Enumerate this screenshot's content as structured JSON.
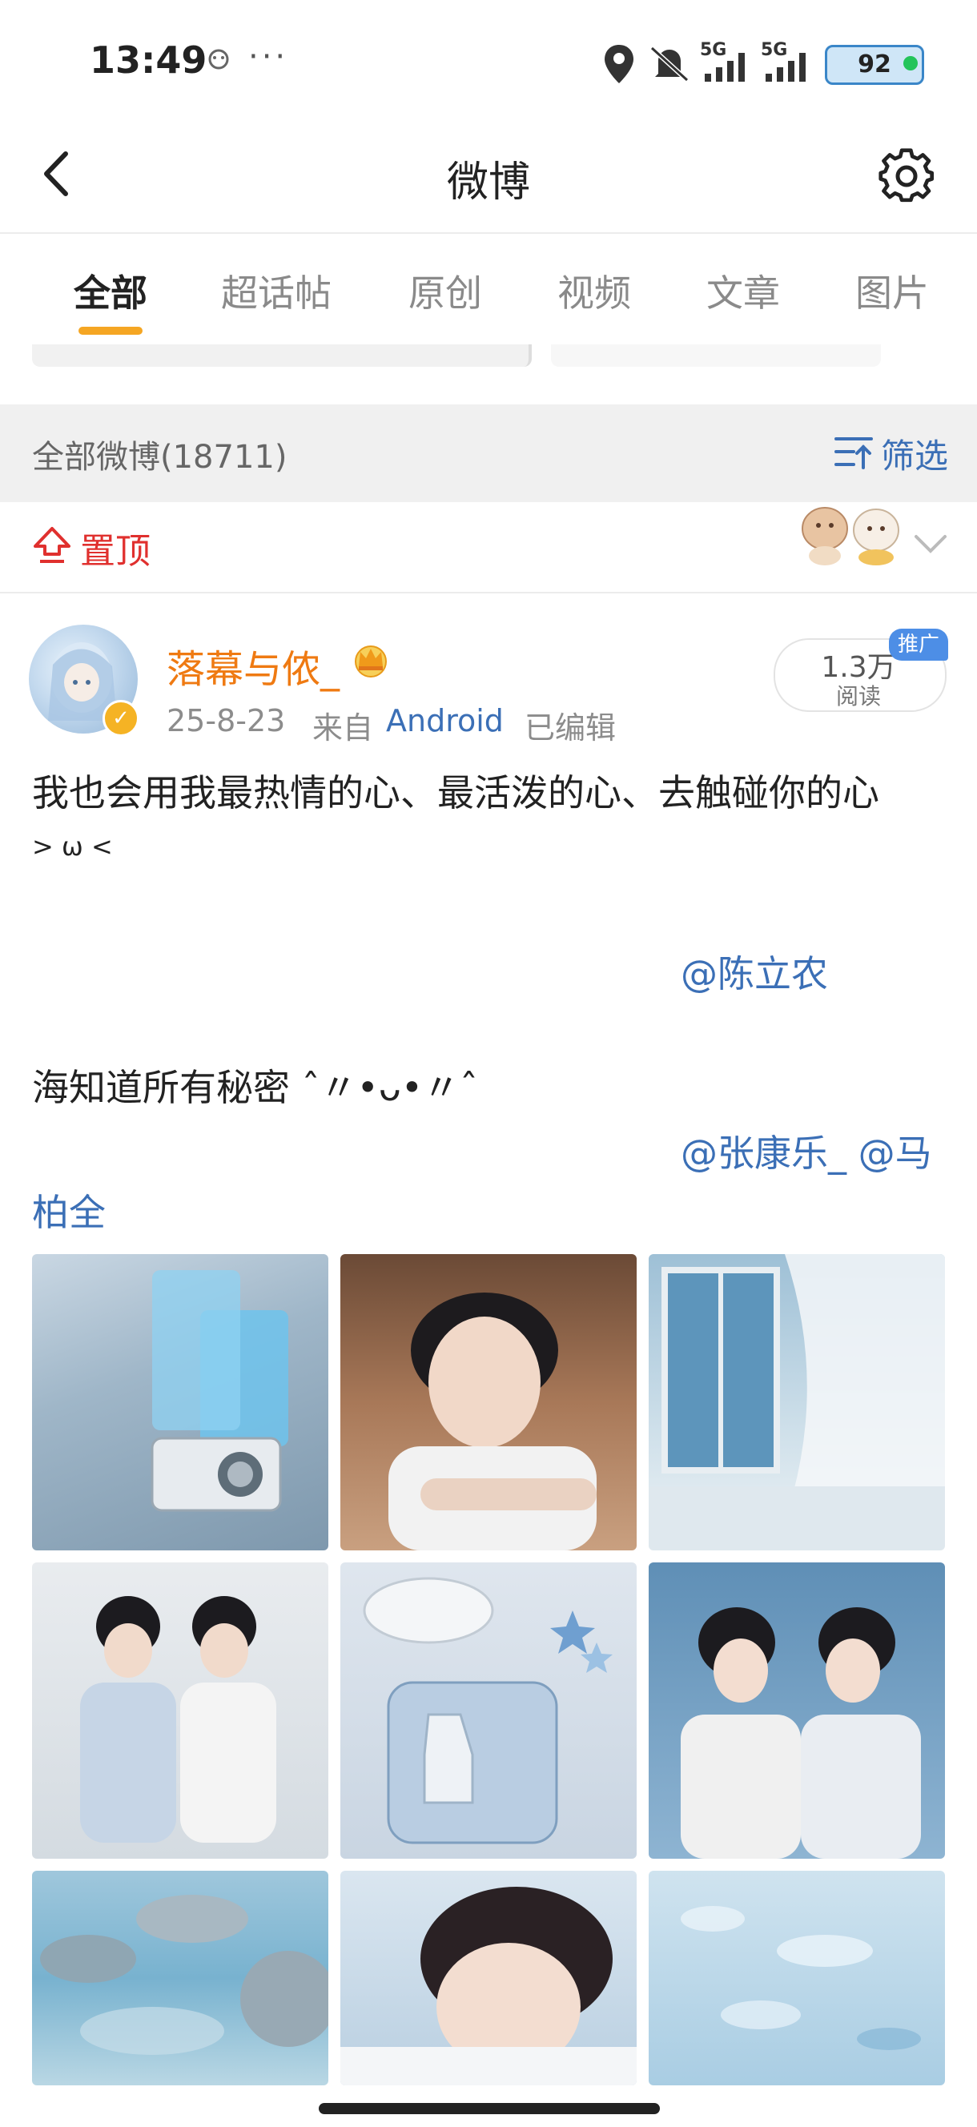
{
  "status_bar": {
    "time": "13:49",
    "more": "···",
    "signal_label_1": "5G",
    "signal_label_2": "5G",
    "battery": "92"
  },
  "nav": {
    "title": "微博"
  },
  "tabs": [
    {
      "label": "全部",
      "active": true
    },
    {
      "label": "超话帖",
      "active": false
    },
    {
      "label": "原创",
      "active": false
    },
    {
      "label": "视频",
      "active": false
    },
    {
      "label": "文章",
      "active": false
    },
    {
      "label": "图片",
      "active": false
    }
  ],
  "feed_header": {
    "all_count": "全部微博(18711)",
    "filter_label": "筛选"
  },
  "pinned": {
    "label": "置顶"
  },
  "post": {
    "username": "落幕与侬_",
    "date": "25-8-23",
    "source_prefix": "来自",
    "source": "Android",
    "edited": "已编辑",
    "reads": "1.3万",
    "reads_label": "阅读",
    "promo": "推广",
    "line1": "我也会用我最热情的心、最活泼的心、去触碰你的心",
    "line2": "> ω <",
    "mention1": "@陈立农",
    "line3": "海知道所有秘密 ˆ〃•ᴗ•〃ˆ",
    "mention2": "@张康乐_ @马",
    "mention2_cont": "柏全"
  },
  "colors": {
    "accent": "#f5a623",
    "link": "#3b6fb6",
    "username": "#ef7a12",
    "pin": "#e0302e"
  },
  "icons": {
    "back": "chevron-left-icon",
    "settings": "gear-icon",
    "filter": "filter-icon",
    "pin": "pin-up-icon",
    "crown": "crown-icon",
    "expand": "chevron-down-icon"
  }
}
